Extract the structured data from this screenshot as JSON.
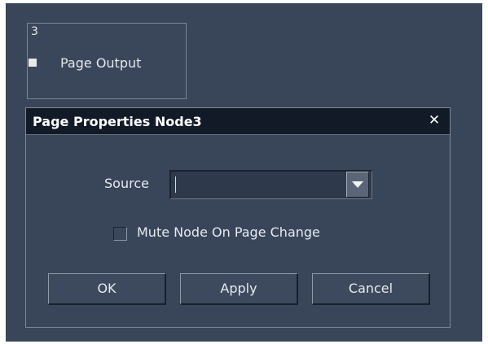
{
  "node": {
    "id": "3",
    "label": "Page Output"
  },
  "dialog": {
    "title": "Page Properties Node3",
    "close_label": "×",
    "source": {
      "label": "Source",
      "value": ""
    },
    "mute_checkbox": {
      "label": "Mute Node On Page Change",
      "checked": false
    },
    "buttons": {
      "ok": "OK",
      "apply": "Apply",
      "cancel": "Cancel"
    }
  },
  "colors": {
    "canvas_bg": "#394659",
    "titlebar_bg": "#121a27",
    "text": "#e6eaf0"
  }
}
